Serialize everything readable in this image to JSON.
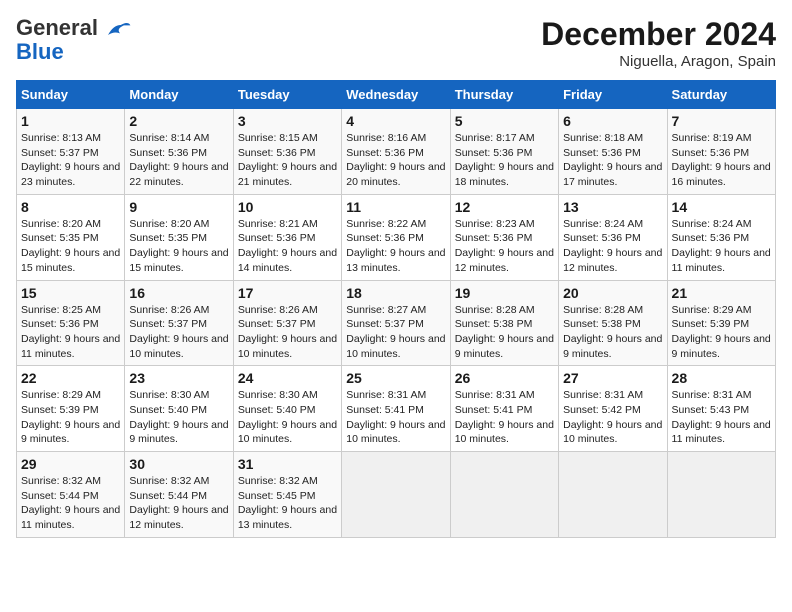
{
  "header": {
    "logo_general": "General",
    "logo_blue": "Blue",
    "month": "December 2024",
    "location": "Niguella, Aragon, Spain"
  },
  "weekdays": [
    "Sunday",
    "Monday",
    "Tuesday",
    "Wednesday",
    "Thursday",
    "Friday",
    "Saturday"
  ],
  "weeks": [
    [
      {
        "day": "1",
        "sunrise": "8:13 AM",
        "sunset": "5:37 PM",
        "daylight": "9 hours and 23 minutes."
      },
      {
        "day": "2",
        "sunrise": "8:14 AM",
        "sunset": "5:36 PM",
        "daylight": "9 hours and 22 minutes."
      },
      {
        "day": "3",
        "sunrise": "8:15 AM",
        "sunset": "5:36 PM",
        "daylight": "9 hours and 21 minutes."
      },
      {
        "day": "4",
        "sunrise": "8:16 AM",
        "sunset": "5:36 PM",
        "daylight": "9 hours and 20 minutes."
      },
      {
        "day": "5",
        "sunrise": "8:17 AM",
        "sunset": "5:36 PM",
        "daylight": "9 hours and 18 minutes."
      },
      {
        "day": "6",
        "sunrise": "8:18 AM",
        "sunset": "5:36 PM",
        "daylight": "9 hours and 17 minutes."
      },
      {
        "day": "7",
        "sunrise": "8:19 AM",
        "sunset": "5:36 PM",
        "daylight": "9 hours and 16 minutes."
      }
    ],
    [
      {
        "day": "8",
        "sunrise": "8:20 AM",
        "sunset": "5:35 PM",
        "daylight": "9 hours and 15 minutes."
      },
      {
        "day": "9",
        "sunrise": "8:20 AM",
        "sunset": "5:35 PM",
        "daylight": "9 hours and 15 minutes."
      },
      {
        "day": "10",
        "sunrise": "8:21 AM",
        "sunset": "5:36 PM",
        "daylight": "9 hours and 14 minutes."
      },
      {
        "day": "11",
        "sunrise": "8:22 AM",
        "sunset": "5:36 PM",
        "daylight": "9 hours and 13 minutes."
      },
      {
        "day": "12",
        "sunrise": "8:23 AM",
        "sunset": "5:36 PM",
        "daylight": "9 hours and 12 minutes."
      },
      {
        "day": "13",
        "sunrise": "8:24 AM",
        "sunset": "5:36 PM",
        "daylight": "9 hours and 12 minutes."
      },
      {
        "day": "14",
        "sunrise": "8:24 AM",
        "sunset": "5:36 PM",
        "daylight": "9 hours and 11 minutes."
      }
    ],
    [
      {
        "day": "15",
        "sunrise": "8:25 AM",
        "sunset": "5:36 PM",
        "daylight": "9 hours and 11 minutes."
      },
      {
        "day": "16",
        "sunrise": "8:26 AM",
        "sunset": "5:37 PM",
        "daylight": "9 hours and 10 minutes."
      },
      {
        "day": "17",
        "sunrise": "8:26 AM",
        "sunset": "5:37 PM",
        "daylight": "9 hours and 10 minutes."
      },
      {
        "day": "18",
        "sunrise": "8:27 AM",
        "sunset": "5:37 PM",
        "daylight": "9 hours and 10 minutes."
      },
      {
        "day": "19",
        "sunrise": "8:28 AM",
        "sunset": "5:38 PM",
        "daylight": "9 hours and 9 minutes."
      },
      {
        "day": "20",
        "sunrise": "8:28 AM",
        "sunset": "5:38 PM",
        "daylight": "9 hours and 9 minutes."
      },
      {
        "day": "21",
        "sunrise": "8:29 AM",
        "sunset": "5:39 PM",
        "daylight": "9 hours and 9 minutes."
      }
    ],
    [
      {
        "day": "22",
        "sunrise": "8:29 AM",
        "sunset": "5:39 PM",
        "daylight": "9 hours and 9 minutes."
      },
      {
        "day": "23",
        "sunrise": "8:30 AM",
        "sunset": "5:40 PM",
        "daylight": "9 hours and 9 minutes."
      },
      {
        "day": "24",
        "sunrise": "8:30 AM",
        "sunset": "5:40 PM",
        "daylight": "9 hours and 10 minutes."
      },
      {
        "day": "25",
        "sunrise": "8:31 AM",
        "sunset": "5:41 PM",
        "daylight": "9 hours and 10 minutes."
      },
      {
        "day": "26",
        "sunrise": "8:31 AM",
        "sunset": "5:41 PM",
        "daylight": "9 hours and 10 minutes."
      },
      {
        "day": "27",
        "sunrise": "8:31 AM",
        "sunset": "5:42 PM",
        "daylight": "9 hours and 10 minutes."
      },
      {
        "day": "28",
        "sunrise": "8:31 AM",
        "sunset": "5:43 PM",
        "daylight": "9 hours and 11 minutes."
      }
    ],
    [
      {
        "day": "29",
        "sunrise": "8:32 AM",
        "sunset": "5:44 PM",
        "daylight": "9 hours and 11 minutes."
      },
      {
        "day": "30",
        "sunrise": "8:32 AM",
        "sunset": "5:44 PM",
        "daylight": "9 hours and 12 minutes."
      },
      {
        "day": "31",
        "sunrise": "8:32 AM",
        "sunset": "5:45 PM",
        "daylight": "9 hours and 13 minutes."
      },
      null,
      null,
      null,
      null
    ]
  ]
}
